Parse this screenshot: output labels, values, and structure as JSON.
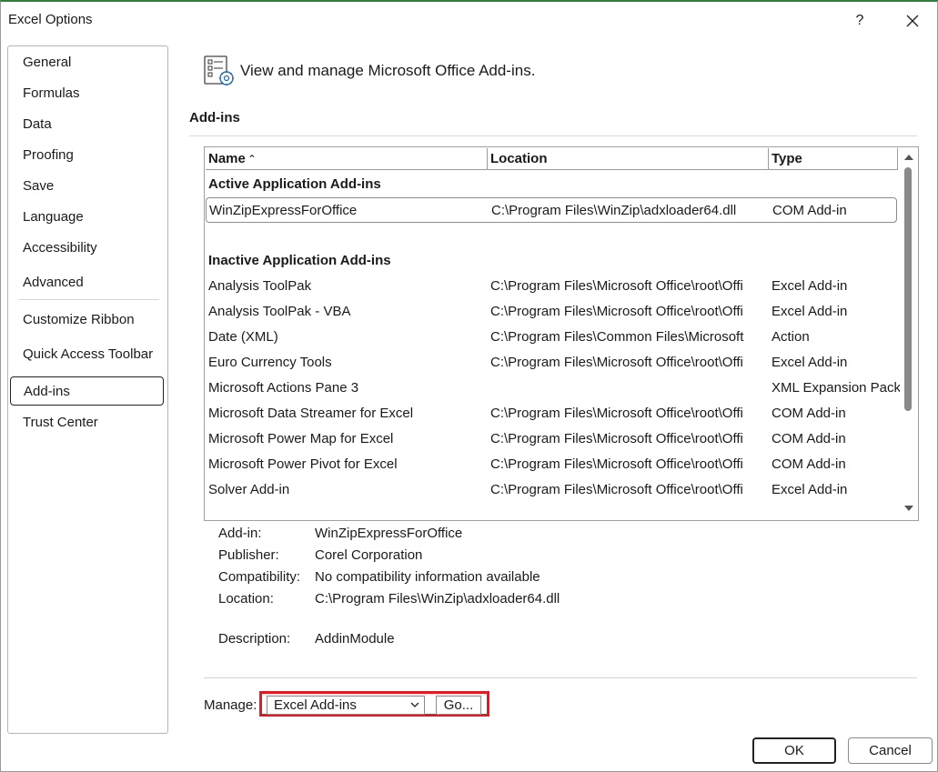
{
  "window": {
    "title": "Excel Options",
    "help_label": "?"
  },
  "sidebar": {
    "items": [
      {
        "label": "General"
      },
      {
        "label": "Formulas"
      },
      {
        "label": "Data"
      },
      {
        "label": "Proofing"
      },
      {
        "label": "Save"
      },
      {
        "label": "Language"
      },
      {
        "label": "Accessibility"
      },
      {
        "label": "Advanced"
      },
      {
        "label": "Customize Ribbon"
      },
      {
        "label": "Quick Access Toolbar"
      },
      {
        "label": "Add-ins"
      },
      {
        "label": "Trust Center"
      }
    ],
    "active": "Add-ins"
  },
  "header": {
    "text": "View and manage Microsoft Office Add-ins."
  },
  "section": {
    "title": "Add-ins"
  },
  "table": {
    "columns": {
      "name": "Name",
      "sort_indicator": "⌃",
      "location": "Location",
      "type": "Type"
    },
    "active_group": "Active Application Add-ins",
    "active_rows": [
      {
        "name": "WinZipExpressForOffice",
        "location": "C:\\Program Files\\WinZip\\adxloader64.dll",
        "type": "COM Add-in"
      }
    ],
    "inactive_group": "Inactive Application Add-ins",
    "inactive_rows": [
      {
        "name": "Analysis ToolPak",
        "location": "C:\\Program Files\\Microsoft Office\\root\\Offi",
        "type": "Excel Add-in"
      },
      {
        "name": "Analysis ToolPak - VBA",
        "location": "C:\\Program Files\\Microsoft Office\\root\\Offi",
        "type": "Excel Add-in"
      },
      {
        "name": "Date (XML)",
        "location": "C:\\Program Files\\Common Files\\Microsoft",
        "type": "Action"
      },
      {
        "name": "Euro Currency Tools",
        "location": "C:\\Program Files\\Microsoft Office\\root\\Offi",
        "type": "Excel Add-in"
      },
      {
        "name": "Microsoft Actions Pane 3",
        "location": "",
        "type": "XML Expansion Pack"
      },
      {
        "name": "Microsoft Data Streamer for Excel",
        "location": "C:\\Program Files\\Microsoft Office\\root\\Offi",
        "type": "COM Add-in"
      },
      {
        "name": "Microsoft Power Map for Excel",
        "location": "C:\\Program Files\\Microsoft Office\\root\\Offi",
        "type": "COM Add-in"
      },
      {
        "name": "Microsoft Power Pivot for Excel",
        "location": "C:\\Program Files\\Microsoft Office\\root\\Offi",
        "type": "COM Add-in"
      },
      {
        "name": "Solver Add-in",
        "location": "C:\\Program Files\\Microsoft Office\\root\\Offi",
        "type": "Excel Add-in"
      }
    ]
  },
  "details": {
    "addin_label": "Add-in:",
    "addin_value": "WinZipExpressForOffice",
    "publisher_label": "Publisher:",
    "publisher_value": "Corel Corporation",
    "compat_label": "Compatibility:",
    "compat_value": "No compatibility information available",
    "location_label": "Location:",
    "location_value": "C:\\Program Files\\WinZip\\adxloader64.dll",
    "desc_label": "Description:",
    "desc_value": "AddinModule"
  },
  "manage": {
    "label": "Manage:",
    "selected": "Excel Add-ins",
    "go_label": "Go..."
  },
  "buttons": {
    "ok": "OK",
    "cancel": "Cancel"
  },
  "colors": {
    "highlight": "#e01b24",
    "title_accent": "#2f7d3b"
  }
}
